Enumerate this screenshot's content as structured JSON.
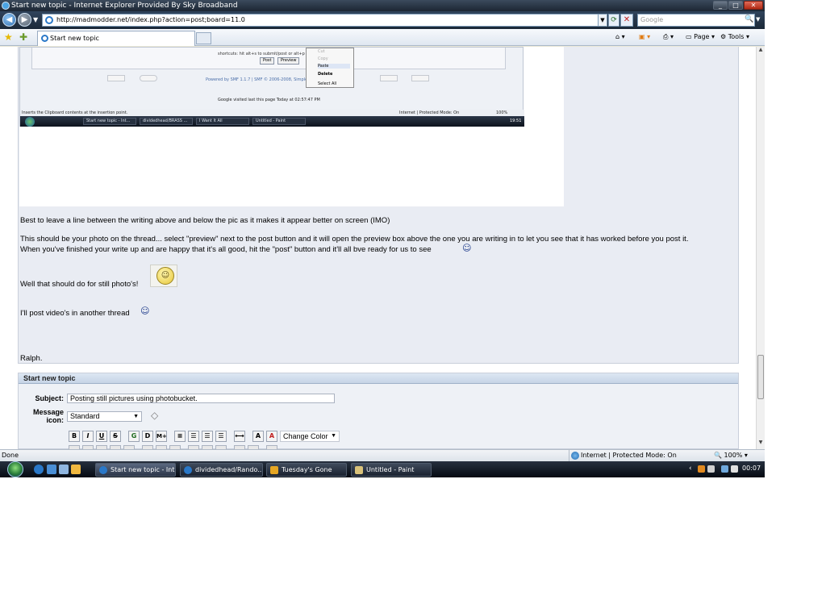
{
  "window": {
    "title": "Start new topic - Internet Explorer Provided By Sky Broadband",
    "min_glyph": "_",
    "max_glyph": "□",
    "close_glyph": "✕"
  },
  "address_bar": {
    "url": "http://madmodder.net/index.php?action=post;board=11.0",
    "search_placeholder": "Google"
  },
  "tabs": [
    {
      "label": "Start new topic"
    }
  ],
  "command_bar": {
    "home_icon": "home-icon",
    "feeds_icon": "rss-icon",
    "print_icon": "print-icon",
    "page_label": "Page",
    "tools_label": "Tools"
  },
  "embedded_screenshot": {
    "hint": "shortcuts: hit alt+s to submit/post or alt+p to preview",
    "post_button": "Post",
    "preview_button": "Preview",
    "powered_by": "Powered by SMF 1.1.7 | SMF © 2006-2008, Simple",
    "visited": "Google visited last this page Today at 02:57:47 PM",
    "context_menu": [
      "Cut",
      "Copy",
      "Paste",
      "Delete",
      "Select All"
    ],
    "status": "Inserts the Clipboard contents at the insertion point.",
    "status_zone": "Internet | Protected Mode: On",
    "status_zoom": "100%",
    "taskbar_items": [
      "Start new topic - Int...",
      "dividedhead/BRASS ...",
      "I Want It All",
      "Untitled - Paint"
    ],
    "clock": "19:51"
  },
  "post": {
    "line1": "Best to leave a line between the writing above and below the pic as it makes it appear better on screen (IMO)",
    "line2a": "This should be your photo on the thread... select \"preview\" next to the post button and it will open the preview box above the one you are writing in to let you see that it has worked before you post it.",
    "line2b": "When you've finished your write up and are happy that it's all good, hit the \"post\" button and it'll all bve ready for us to see",
    "line3": "Well that should do for still photo's!",
    "line4": "I'll post video's in another thread",
    "signature": "Ralph."
  },
  "topic_form": {
    "header": "Start new topic",
    "subject_label": "Subject:",
    "subject_value": "Posting still pictures using photobucket.",
    "message_icon_label_1": "Message",
    "message_icon_label_2": "icon:",
    "message_icon_value": "Standard",
    "toolbar": [
      "B",
      "I",
      "U",
      "S",
      "G",
      "D",
      "M+"
    ],
    "change_color": "Change Color"
  },
  "status_bar": {
    "text": "Done",
    "zone": "Internet | Protected Mode: On",
    "zoom": "100%"
  },
  "taskbar": {
    "items": [
      {
        "label": "Start new topic - Int...",
        "active": true
      },
      {
        "label": "dividedhead/Rando...",
        "active": false
      },
      {
        "label": "Tuesday's Gone",
        "active": false
      },
      {
        "label": "Untitled - Paint",
        "active": false
      }
    ],
    "clock": "00:07"
  }
}
